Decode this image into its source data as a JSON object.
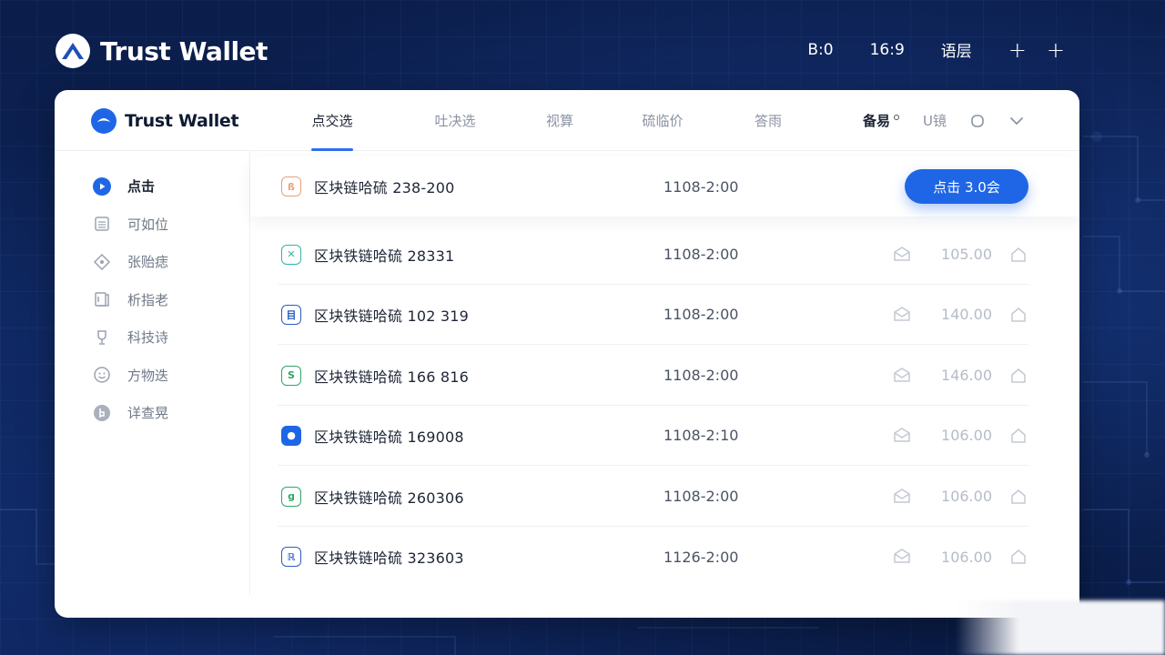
{
  "top_bar": {
    "brand": "Trust Wallet",
    "items": [
      "B:0",
      "16:9",
      "语层"
    ],
    "plus_1": "+",
    "plus_2": "+"
  },
  "window": {
    "brand": "Trust Wallet",
    "tabs": [
      {
        "label": "点交选",
        "active": true
      },
      {
        "label": "吐决选",
        "active": false
      },
      {
        "label": "视算",
        "active": false
      },
      {
        "label": "硫临价",
        "active": false
      },
      {
        "label": "答雨",
        "active": false
      }
    ],
    "header_right": {
      "primary": "备易",
      "secondary": "U镜"
    },
    "sidebar": [
      {
        "label": "点击",
        "icon": "play-circle-icon",
        "active": true
      },
      {
        "label": "可如位",
        "icon": "list-icon",
        "active": false
      },
      {
        "label": "张贻痣",
        "icon": "tag-icon",
        "active": false
      },
      {
        "label": "析指老",
        "icon": "book-icon",
        "active": false
      },
      {
        "label": "科技诗",
        "icon": "trophy-icon",
        "active": false
      },
      {
        "label": "方物迭",
        "icon": "smile-icon",
        "active": false
      },
      {
        "label": "详查晃",
        "icon": "badge-icon",
        "active": false
      }
    ],
    "rows": [
      {
        "name": "区块链哈硫 238-200",
        "time": "1108-2:00",
        "action": "点击 3.0会",
        "icon_glyph": "ß",
        "icon_color": "#e8a07a"
      },
      {
        "name": "区块铁链哈硫 28331",
        "time": "1108-2:00",
        "amount": "105.00",
        "icon_glyph": "✕",
        "icon_color": "#2fb4a7"
      },
      {
        "name": "区块铁链哈硫 102 319",
        "time": "1108-2:00",
        "amount": "140.00",
        "icon_glyph": "目",
        "icon_color": "#2a5fbf"
      },
      {
        "name": "区块铁链哈硫 166 816",
        "time": "1108-2:00",
        "amount": "146.00",
        "icon_glyph": "S",
        "icon_color": "#2fa766"
      },
      {
        "name": "区块铁链哈硫 169008",
        "time": "1108-2:10",
        "amount": "106.00",
        "icon_glyph": "●",
        "icon_color": "#1f66e6",
        "icon_filled": true
      },
      {
        "name": "区块铁链哈硫 260306",
        "time": "1108-2:00",
        "amount": "106.00",
        "icon_glyph": "g",
        "icon_color": "#2fa766"
      },
      {
        "name": "区块铁链哈硫 323603",
        "time": "1126-2:00",
        "amount": "106.00",
        "icon_glyph": "ℝ",
        "icon_color": "#2a5fbf"
      }
    ]
  }
}
